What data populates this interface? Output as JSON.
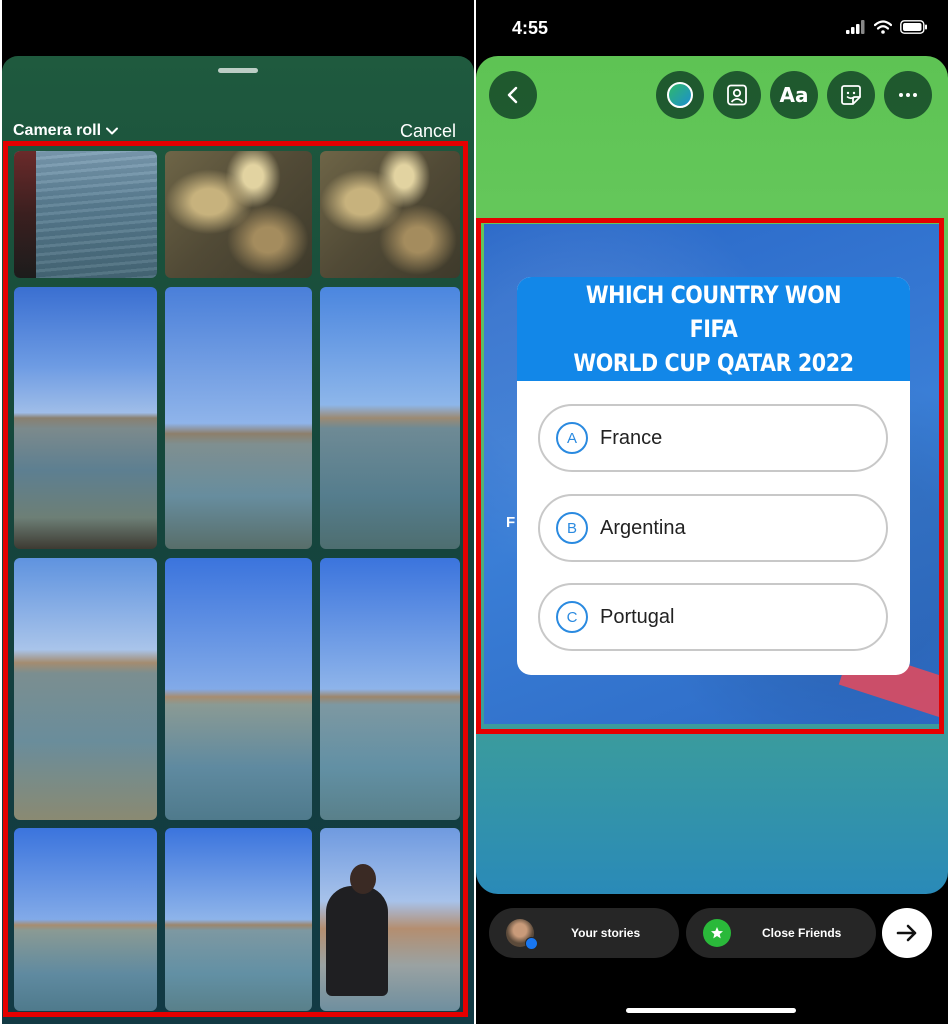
{
  "left": {
    "picker_title": "Camera roll",
    "cancel_label": "Cancel",
    "photo_count": 12
  },
  "right": {
    "status": {
      "time": "4:55"
    },
    "toolbar": {
      "back_icon": "chevron-left-icon",
      "color_icon": "color-picker-icon",
      "portrait_icon": "portrait-icon",
      "text_label": "Aa",
      "sticker_icon": "sticker-icon",
      "more_icon": "more-icon"
    },
    "quiz": {
      "question": "WHICH COUNTRY WON FIFA\nWORLD CUP QATAR 2022",
      "options": [
        {
          "letter": "A",
          "text": "France"
        },
        {
          "letter": "B",
          "text": "Argentina"
        },
        {
          "letter": "C",
          "text": "Portugal"
        }
      ]
    },
    "poster_partial_text": "F",
    "share": {
      "your_stories": "Your stories",
      "close_friends": "Close Friends"
    }
  },
  "colors": {
    "highlight": "#e50000",
    "quiz_header": "#1287e8",
    "option_accent": "#2a8ae0"
  }
}
